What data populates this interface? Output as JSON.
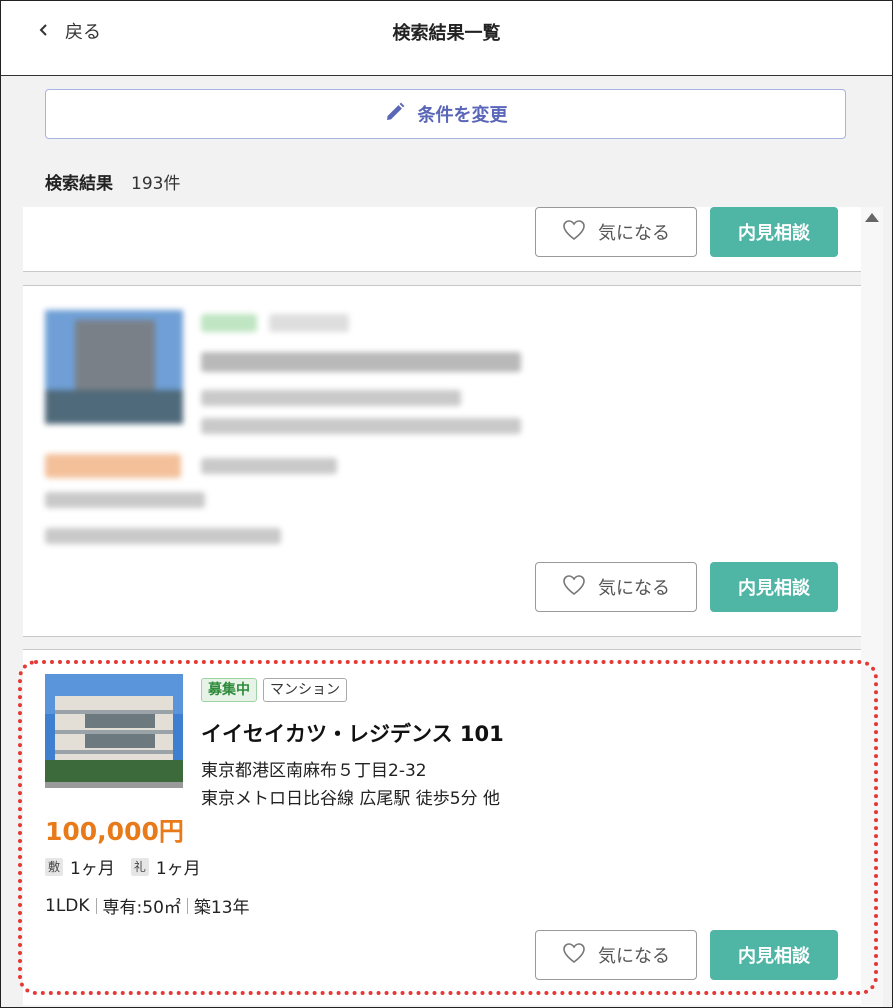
{
  "header": {
    "back_label": "戻る",
    "title": "検索結果一覧"
  },
  "condition_button": {
    "label": "条件を変更"
  },
  "results": {
    "heading": "検索結果",
    "count": "193件"
  },
  "card_actions": {
    "favorite_label": "気になる",
    "viewing_label": "内見相談"
  },
  "featured": {
    "status_tag": "募集中",
    "type_tag": "マンション",
    "name": "イイセイカツ・レジデンス 101",
    "address": "東京都港区南麻布５丁目2-32",
    "access": "東京メトロ日比谷線 広尾駅 徒歩5分 他",
    "price": "100,000円",
    "deposit_icon": "敷",
    "deposit": "1ヶ月",
    "key_money_icon": "礼",
    "key_money": "1ヶ月",
    "layout": "1LDK",
    "area": "専有:50㎡",
    "age": "築13年"
  },
  "colors": {
    "accent_teal": "#4fb5a5",
    "price_orange": "#e87a1a",
    "status_green": "#2e8b3c",
    "condition_blue": "#5a66b8",
    "highlight_red": "#e53935"
  }
}
